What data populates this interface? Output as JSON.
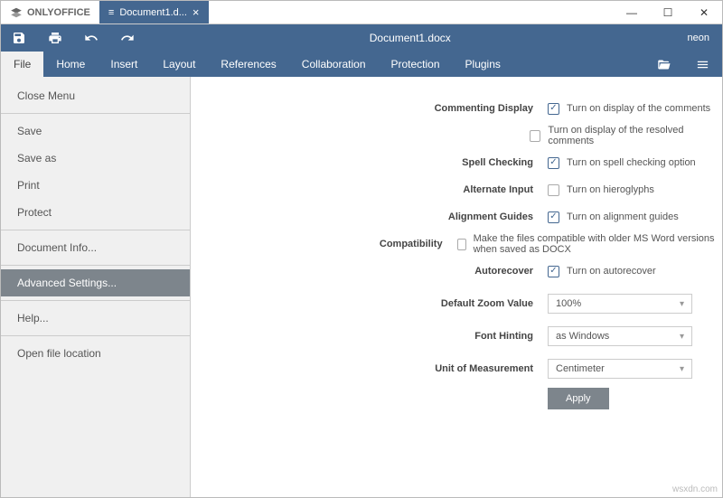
{
  "app": {
    "brand": "ONLYOFFICE",
    "tab": "Document1.d...",
    "doc_title": "Document1.docx",
    "user": "neon"
  },
  "menubar": {
    "items": [
      "File",
      "Home",
      "Insert",
      "Layout",
      "References",
      "Collaboration",
      "Protection",
      "Plugins"
    ]
  },
  "sidebar": {
    "close": "Close Menu",
    "save": "Save",
    "save_as": "Save as",
    "print": "Print",
    "protect": "Protect",
    "doc_info": "Document Info...",
    "adv": "Advanced Settings...",
    "help": "Help...",
    "open_loc": "Open file location"
  },
  "settings": {
    "commenting": {
      "label": "Commenting Display",
      "opt1": "Turn on display of the comments",
      "opt2": "Turn on display of the resolved comments"
    },
    "spell": {
      "label": "Spell Checking",
      "opt": "Turn on spell checking option"
    },
    "altinput": {
      "label": "Alternate Input",
      "opt": "Turn on hieroglyphs"
    },
    "guides": {
      "label": "Alignment Guides",
      "opt": "Turn on alignment guides"
    },
    "compat": {
      "label": "Compatibility",
      "opt": "Make the files compatible with older MS Word versions when saved as DOCX"
    },
    "autorec": {
      "label": "Autorecover",
      "opt": "Turn on autorecover"
    },
    "zoom": {
      "label": "Default Zoom Value",
      "value": "100%"
    },
    "hinting": {
      "label": "Font Hinting",
      "value": "as Windows"
    },
    "unit": {
      "label": "Unit of Measurement",
      "value": "Centimeter"
    },
    "apply": "Apply"
  },
  "watermark": "wsxdn.com"
}
